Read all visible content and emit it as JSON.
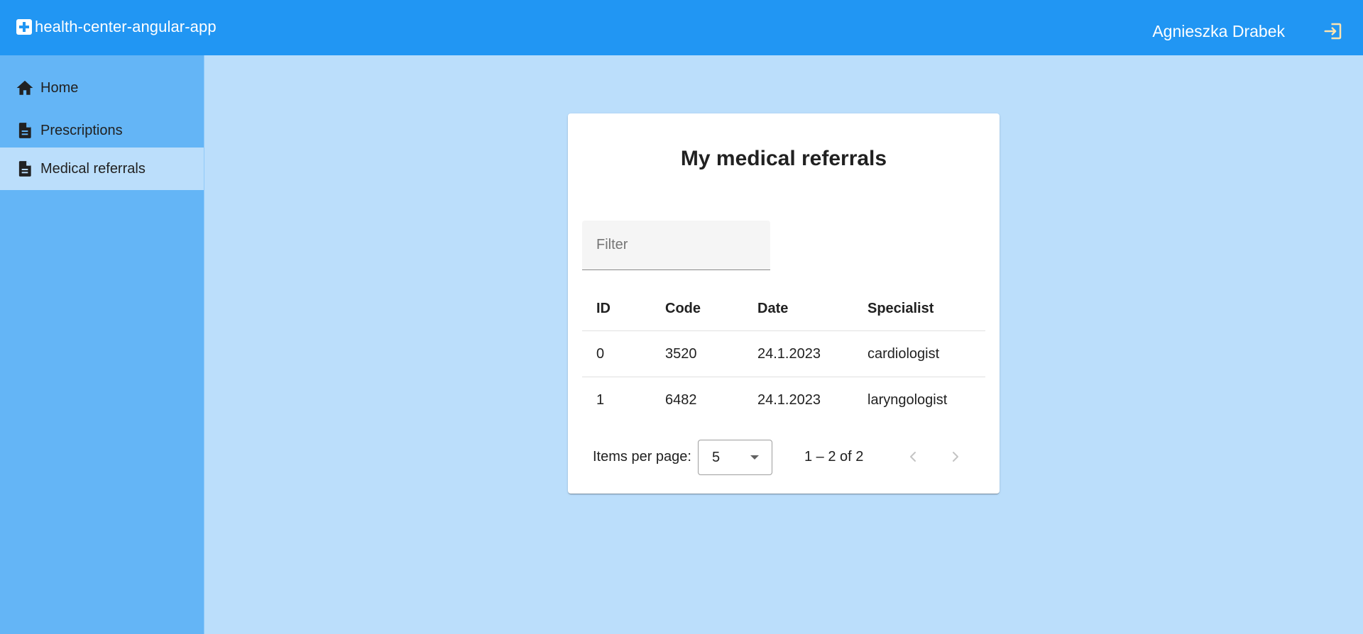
{
  "app": {
    "title": "health-center-angular-app",
    "brand_icon": "medical-cross-icon",
    "user_name": "Agnieszka Drabek",
    "logout_icon": "logout-icon"
  },
  "sidebar": {
    "items": [
      {
        "label": "Home",
        "icon": "home-icon",
        "active": false
      },
      {
        "label": "Prescriptions",
        "icon": "document-icon",
        "active": false
      },
      {
        "label": "Medical referrals",
        "icon": "document-icon",
        "active": true
      }
    ]
  },
  "main": {
    "title": "My medical referrals",
    "filter": {
      "placeholder": "Filter",
      "value": ""
    },
    "table": {
      "columns": [
        "ID",
        "Code",
        "Date",
        "Specialist"
      ],
      "rows": [
        [
          "0",
          "3520",
          "24.1.2023",
          "cardiologist"
        ],
        [
          "1",
          "6482",
          "24.1.2023",
          "laryngologist"
        ]
      ]
    },
    "paginator": {
      "items_per_page_label": "Items per page:",
      "page_size": "5",
      "range_label": "1 – 2 of 2",
      "prev_icon": "chevron-left-icon",
      "next_icon": "chevron-right-icon"
    }
  },
  "colors": {
    "toolbar": "#2196f3",
    "sidebar": "#64b5f6",
    "background": "#bbdefb",
    "card": "#ffffff"
  }
}
